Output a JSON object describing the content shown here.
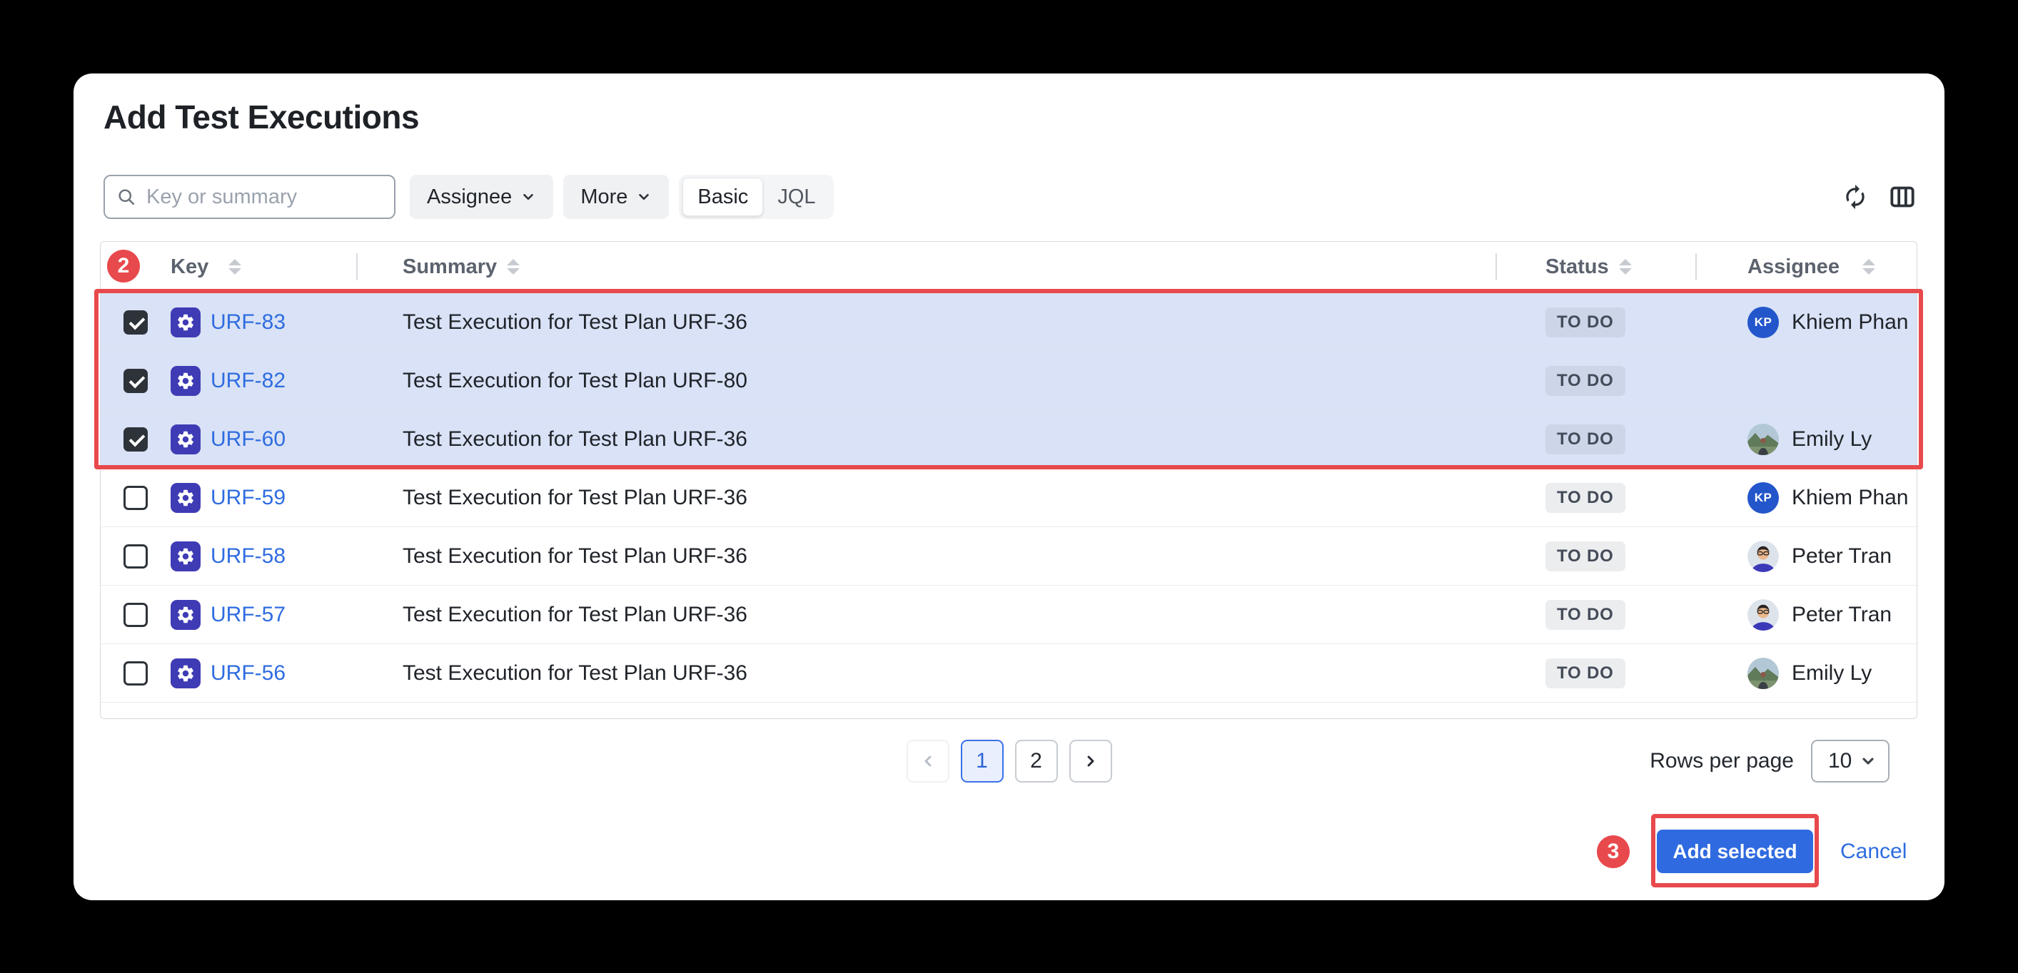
{
  "window": {
    "title": "Add Test Executions"
  },
  "filters": {
    "search_placeholder": "Key or summary",
    "search_value": "",
    "assignee_button": "Assignee",
    "more_button": "More",
    "view_basic": "Basic",
    "view_jql": "JQL"
  },
  "toolbar_icons": {
    "refresh": "refresh-icon",
    "columns": "columns-icon"
  },
  "table": {
    "columns": [
      {
        "label": "Key"
      },
      {
        "label": "Summary"
      },
      {
        "label": "Status"
      },
      {
        "label": "Assignee"
      }
    ],
    "rows": [
      {
        "key": "URF-83",
        "summary": "Test Execution for Test Plan URF-36",
        "status": "TO DO",
        "assignee": "Khiem Phan",
        "avatar": "kp-initials",
        "initials": "KP",
        "checked": true,
        "selected": true
      },
      {
        "key": "URF-82",
        "summary": "Test Execution for Test Plan URF-80",
        "status": "TO DO",
        "assignee": "",
        "avatar": null,
        "checked": true,
        "selected": true
      },
      {
        "key": "URF-60",
        "summary": "Test Execution for Test Plan URF-36",
        "status": "TO DO",
        "assignee": "Emily Ly",
        "avatar": "emily-photo",
        "checked": true,
        "selected": true
      },
      {
        "key": "URF-59",
        "summary": "Test Execution for Test Plan URF-36",
        "status": "TO DO",
        "assignee": "Khiem Phan",
        "avatar": "kp-initials",
        "initials": "KP",
        "checked": false,
        "selected": false
      },
      {
        "key": "URF-58",
        "summary": "Test Execution for Test Plan URF-36",
        "status": "TO DO",
        "assignee": "Peter Tran",
        "avatar": "peter-photo",
        "checked": false,
        "selected": false
      },
      {
        "key": "URF-57",
        "summary": "Test Execution for Test Plan URF-36",
        "status": "TO DO",
        "assignee": "Peter Tran",
        "avatar": "peter-photo",
        "checked": false,
        "selected": false
      },
      {
        "key": "URF-56",
        "summary": "Test Execution for Test Plan URF-36",
        "status": "TO DO",
        "assignee": "Emily Ly",
        "avatar": "emily-photo",
        "checked": false,
        "selected": false
      }
    ]
  },
  "pagination": {
    "pages": [
      "1",
      "2"
    ],
    "active_page": "1"
  },
  "rows_per_page": {
    "label": "Rows per page",
    "value": "10"
  },
  "footer_actions": {
    "add_selected": "Add selected",
    "cancel": "Cancel"
  },
  "annotations": {
    "selection_badge": "2",
    "action_badge": "3"
  },
  "colors": {
    "accent_blue": "#2f6ae0",
    "link_blue": "#2e6ce0",
    "annotation_red": "#e8494c",
    "selected_row_bg": "#d9e2f6",
    "status_badge_bg": "#ecedef",
    "status_badge_text": "#454c59",
    "issue_icon_bg": "#3f3bb5",
    "avatar_blue": "#2356cb"
  }
}
